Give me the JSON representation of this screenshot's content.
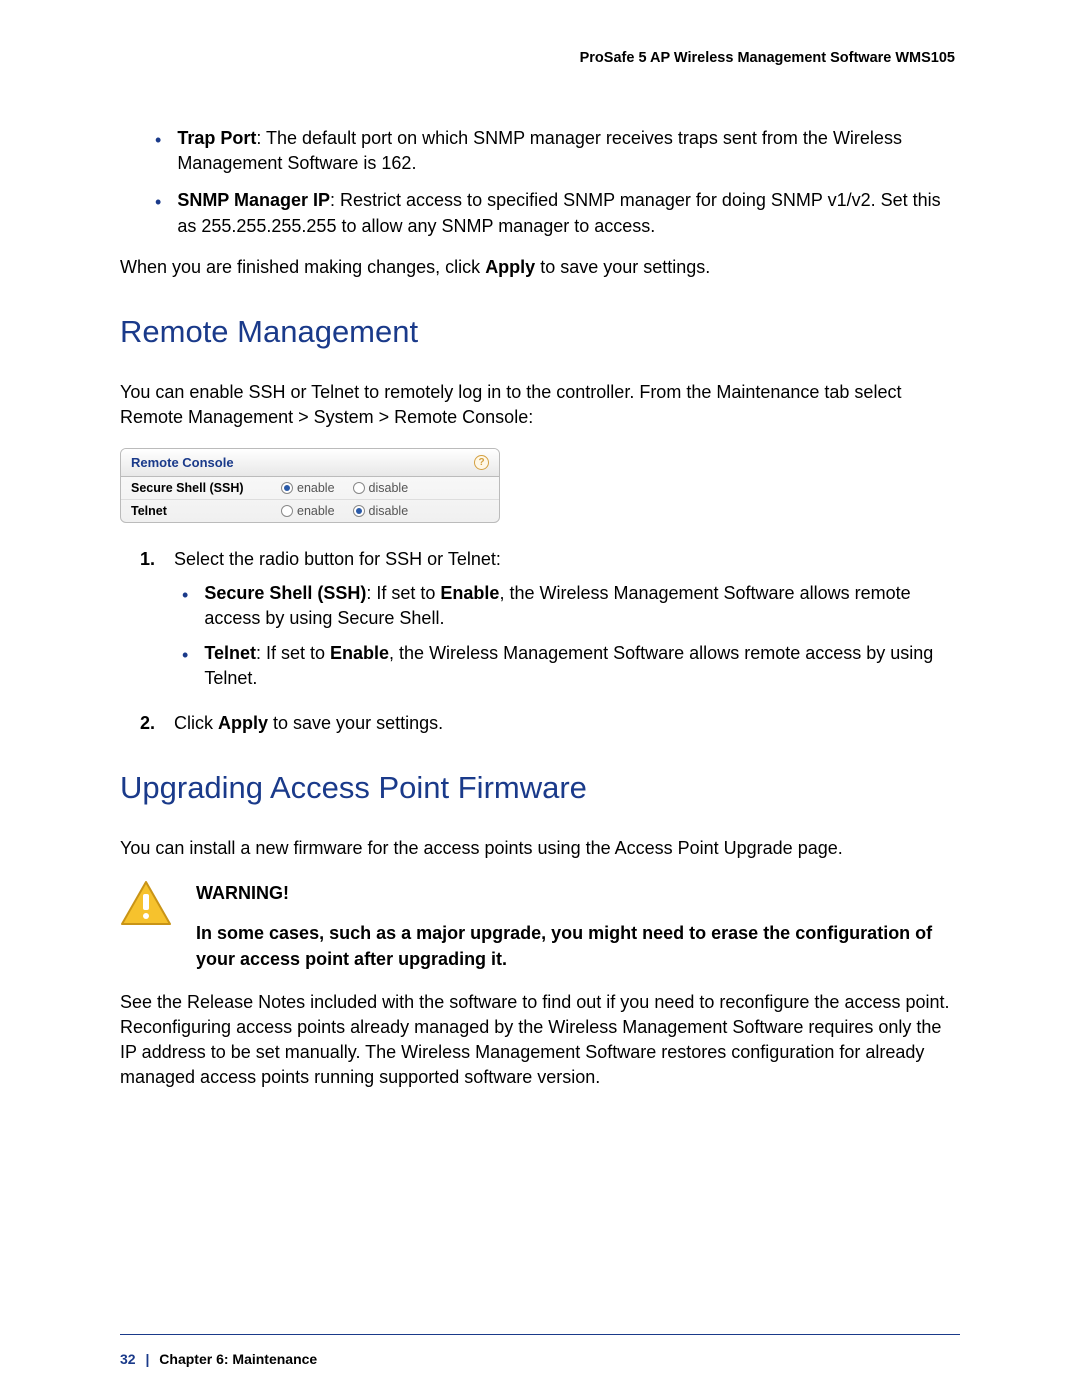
{
  "header": {
    "title": "ProSafe 5 AP Wireless Management Software WMS105"
  },
  "top_bullets": [
    {
      "bold": "Trap Port",
      "text": ": The default port on which SNMP manager receives traps sent from the Wireless Management Software is 162."
    },
    {
      "bold": "SNMP Manager IP",
      "text": ": Restrict access to specified SNMP manager for doing SNMP v1/v2. Set this as 255.255.255.255 to allow any SNMP manager to access."
    }
  ],
  "apply_note_prefix": "When you are finished making changes, click ",
  "apply_note_bold": "Apply",
  "apply_note_suffix": " to save your settings.",
  "section1": {
    "title": "Remote Management",
    "intro": "You can enable SSH or Telnet to remotely log in to the controller. From the Maintenance tab select Remote Management > System > Remote Console:"
  },
  "console": {
    "title": "Remote Console",
    "rows": [
      {
        "label": "Secure Shell (SSH)",
        "enable": "enable",
        "disable": "disable",
        "selected": "enable"
      },
      {
        "label": "Telnet",
        "enable": "enable",
        "disable": "disable",
        "selected": "disable"
      }
    ]
  },
  "steps": {
    "step1_text": "Select the radio button for SSH or Telnet:",
    "step1_subs": [
      {
        "bold1": "Secure Shell (SSH)",
        "mid": ": If set to ",
        "bold2": "Enable",
        "tail": ", the Wireless Management Software allows remote access by using Secure Shell."
      },
      {
        "bold1": "Telnet",
        "mid": ": If set to ",
        "bold2": "Enable",
        "tail": ", the Wireless Management Software allows remote access by using Telnet."
      }
    ],
    "step2_prefix": "Click ",
    "step2_bold": "Apply",
    "step2_suffix": " to save your settings."
  },
  "section2": {
    "title": "Upgrading Access Point Firmware",
    "intro": "You can install a new firmware for the access points using the Access Point Upgrade page."
  },
  "warning": {
    "heading": "WARNING!",
    "body": "In some cases, such as a major upgrade, you might need to erase the configuration of your access point after upgrading it."
  },
  "post_warning": "See the Release Notes included with the software to find out if you need to reconfigure the access point. Reconfiguring access points already managed by the Wireless Management Software requires only the IP address to be set manually. The Wireless Management Software restores configuration for already managed access points running supported software version.",
  "footer": {
    "page": "32",
    "chapter": "Chapter 6:  Maintenance"
  }
}
